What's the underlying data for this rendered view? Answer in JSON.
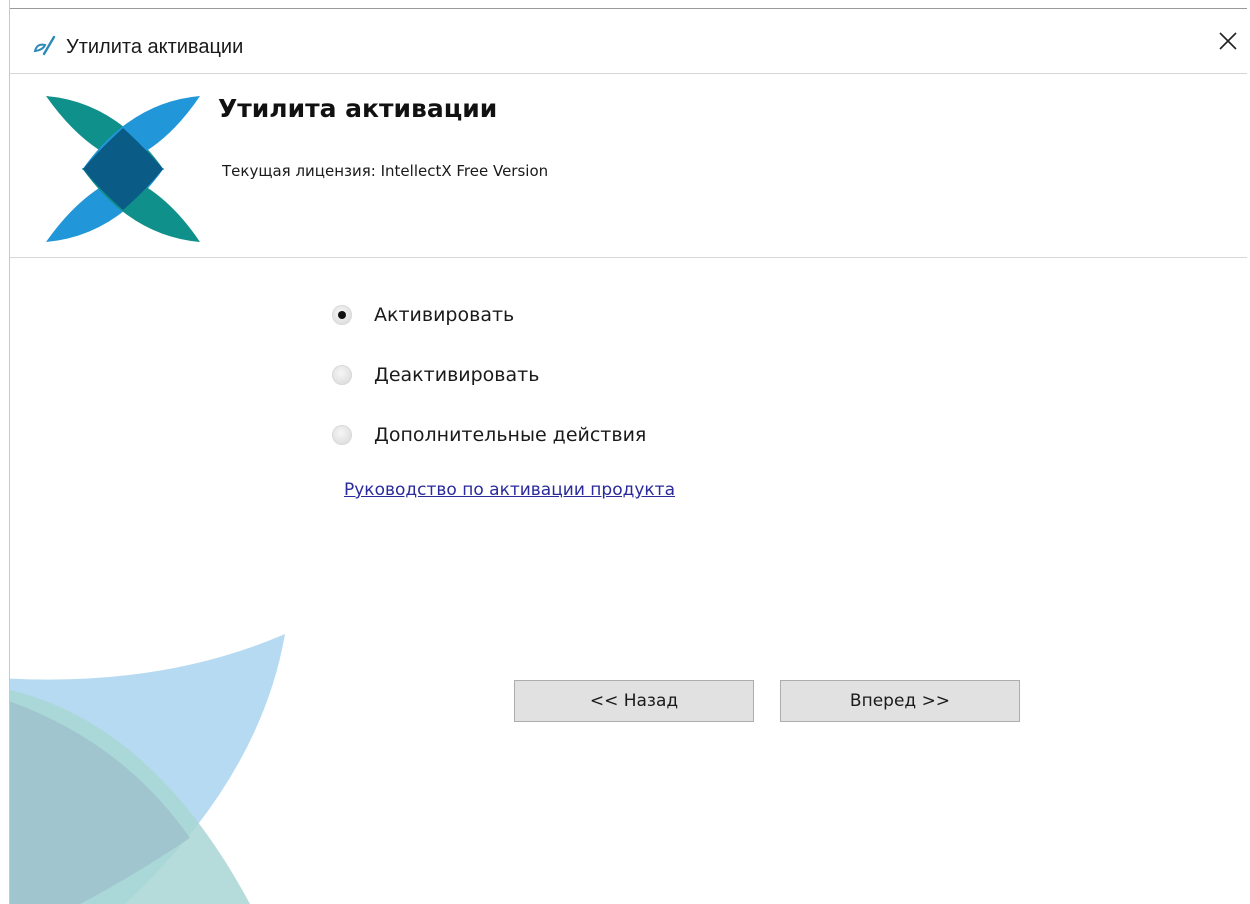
{
  "window": {
    "title": "Утилита активации",
    "close_glyph": "✕"
  },
  "header": {
    "title": "Утилита активации",
    "license_label": "Текущая лицензия:",
    "license_value": "IntellectX Free Version"
  },
  "options": [
    {
      "label": "Активировать",
      "checked": true
    },
    {
      "label": "Деактивировать",
      "checked": false
    },
    {
      "label": "Дополнительные действия",
      "checked": false
    }
  ],
  "guide_link": "Руководство по активации продукта",
  "buttons": {
    "back": "<< Назад",
    "next": "Вперед >>"
  },
  "colors": {
    "logo_teal": "#10908a",
    "logo_blue": "#2196d8",
    "logo_dark": "#0a5b86",
    "link": "#2a2a9c"
  },
  "icons": {
    "app": "app-logo-icon",
    "close": "close-icon"
  }
}
